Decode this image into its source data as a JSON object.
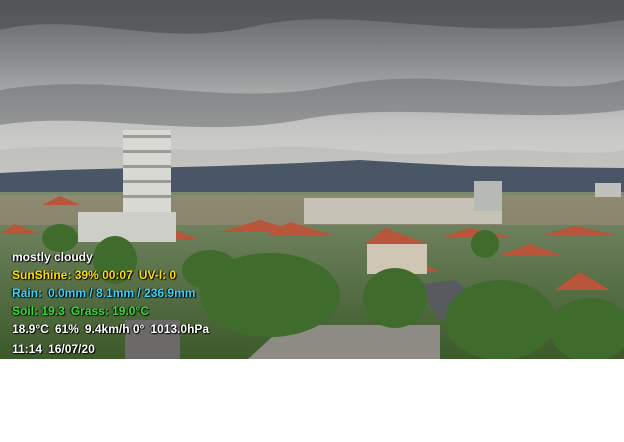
{
  "overlay": {
    "condition": "mostly cloudy",
    "sunshine": {
      "label": "SunShine:",
      "percent": "39%",
      "duration": "00:07",
      "uvi": "UV-I: 0"
    },
    "rain": {
      "label": "Rain:",
      "value": "0.0mm / 8.1mm / 236.9mm"
    },
    "soil": {
      "soil": "Soil: 19.3",
      "grass": "Grass: 19.0°C"
    },
    "weather": {
      "temp": "18.9°C",
      "humidity": "61%",
      "wind": "9.4km/h 0°",
      "pressure": "1013.0hPa"
    },
    "datetime": {
      "time": "11:14",
      "date": "16/07/20"
    }
  },
  "colors": {
    "sun_text": "#ffe000",
    "rain_text": "#33d6ff",
    "soil_text": "#33e033",
    "text": "#ffffff"
  }
}
